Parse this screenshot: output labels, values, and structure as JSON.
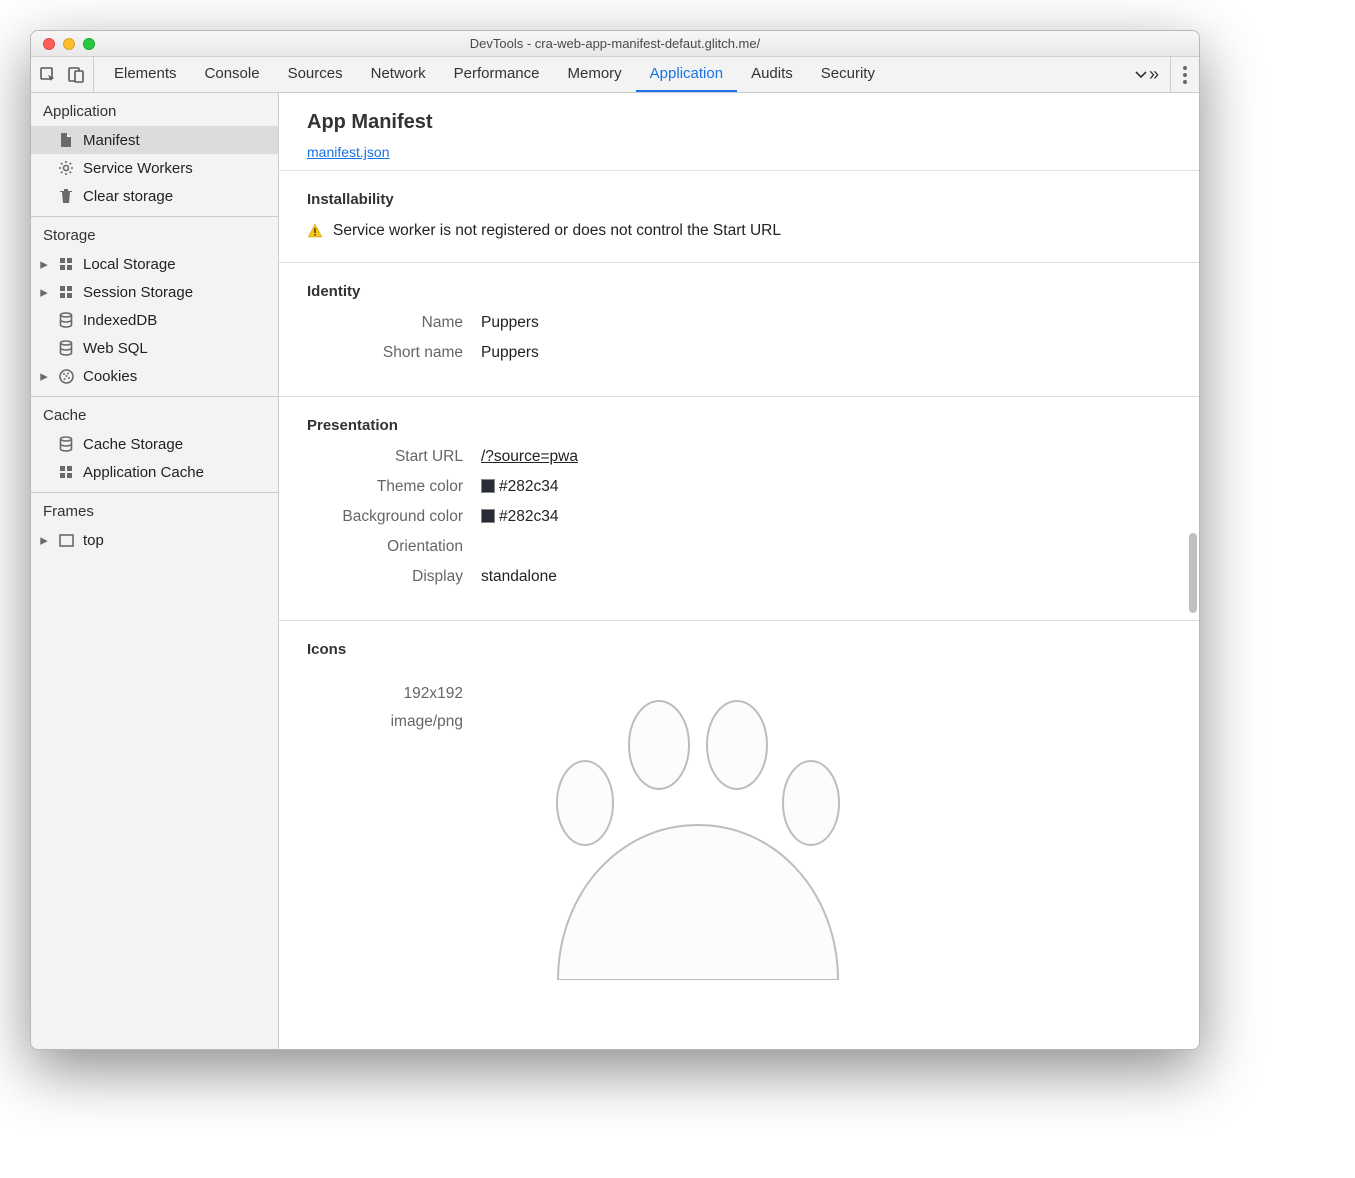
{
  "window_title": "DevTools - cra-web-app-manifest-defaut.glitch.me/",
  "tabs": [
    "Elements",
    "Console",
    "Sources",
    "Network",
    "Performance",
    "Memory",
    "Application",
    "Audits",
    "Security"
  ],
  "active_tab": "Application",
  "sidebar": {
    "groups": [
      {
        "title": "Application",
        "items": [
          {
            "label": "Manifest",
            "icon": "file-icon",
            "caret": false,
            "selected": true
          },
          {
            "label": "Service Workers",
            "icon": "gear-icon",
            "caret": false
          },
          {
            "label": "Clear storage",
            "icon": "trash-icon",
            "caret": false
          }
        ]
      },
      {
        "title": "Storage",
        "items": [
          {
            "label": "Local Storage",
            "icon": "grid-icon",
            "caret": true
          },
          {
            "label": "Session Storage",
            "icon": "grid-icon",
            "caret": true
          },
          {
            "label": "IndexedDB",
            "icon": "database-icon",
            "caret": false
          },
          {
            "label": "Web SQL",
            "icon": "database-icon",
            "caret": false
          },
          {
            "label": "Cookies",
            "icon": "cookie-icon",
            "caret": true
          }
        ]
      },
      {
        "title": "Cache",
        "items": [
          {
            "label": "Cache Storage",
            "icon": "database-icon",
            "caret": false
          },
          {
            "label": "Application Cache",
            "icon": "grid-icon",
            "caret": false
          }
        ]
      },
      {
        "title": "Frames",
        "items": [
          {
            "label": "top",
            "icon": "frame-icon",
            "caret": true
          }
        ]
      }
    ]
  },
  "manifest": {
    "title": "App Manifest",
    "link": "manifest.json",
    "installability_title": "Installability",
    "installability_warning": "Service worker is not registered or does not control the Start URL",
    "identity_title": "Identity",
    "identity": {
      "name_label": "Name",
      "name_value": "Puppers",
      "shortname_label": "Short name",
      "shortname_value": "Puppers"
    },
    "presentation_title": "Presentation",
    "presentation": {
      "starturl_label": "Start URL",
      "starturl_value": "/?source=pwa",
      "theme_label": "Theme color",
      "theme_value": "#282c34",
      "bg_label": "Background color",
      "bg_value": "#282c34",
      "orientation_label": "Orientation",
      "orientation_value": "",
      "display_label": "Display",
      "display_value": "standalone"
    },
    "icons_title": "Icons",
    "icon_size": "192x192",
    "icon_mime": "image/png"
  }
}
